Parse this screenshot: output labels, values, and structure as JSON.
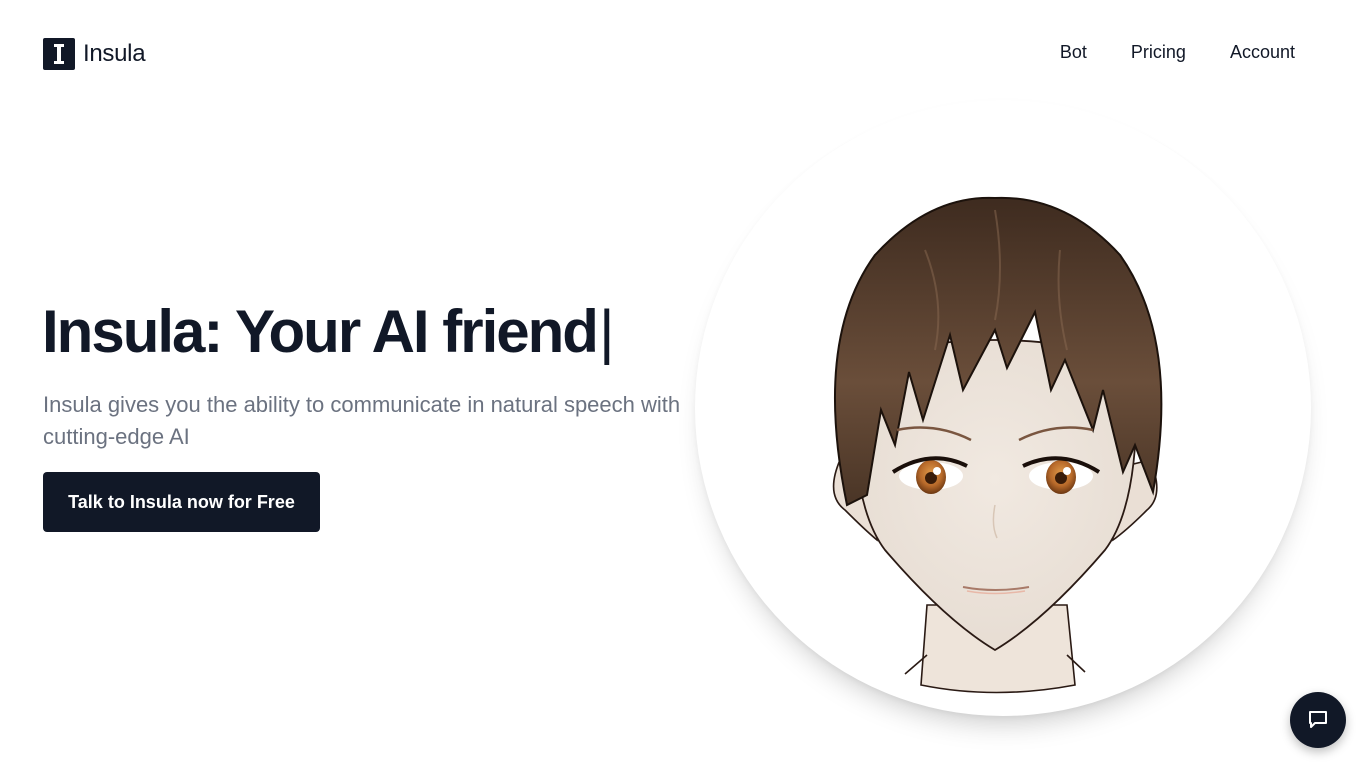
{
  "brand": {
    "name": "Insula",
    "logo_letter": "I",
    "color": "#111827"
  },
  "nav": {
    "items": [
      {
        "label": "Bot"
      },
      {
        "label": "Pricing"
      },
      {
        "label": "Account"
      }
    ]
  },
  "hero": {
    "title": "Insula: Your AI friend",
    "caret": "|",
    "subtitle": "Insula gives you the ability to communicate in natural speech with cutting-edge AI",
    "cta_label": "Talk to Insula now for Free"
  },
  "avatar": {
    "icon": "anime-character-face",
    "hair_color": "#5a4130",
    "eye_color": "#b86a2a",
    "skin_color": "#efe6dd"
  },
  "chat_widget": {
    "icon": "chat-bubble-icon"
  }
}
